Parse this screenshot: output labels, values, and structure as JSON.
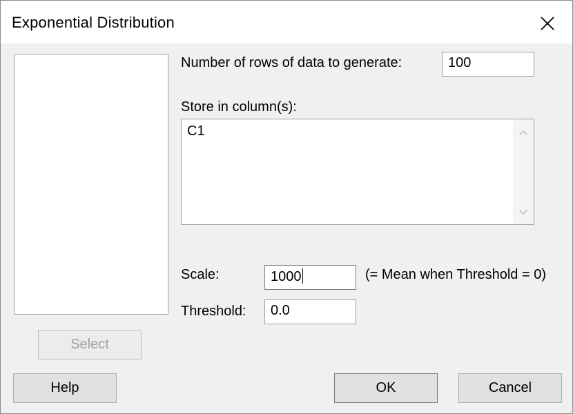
{
  "window": {
    "title": "Exponential Distribution"
  },
  "form": {
    "rows_label": "Number of rows of data to generate:",
    "rows_value": "100",
    "store_label": "Store in column(s):",
    "store_value": "C1",
    "scale_label": "Scale:",
    "scale_value": "1000",
    "scale_note": "(= Mean when Threshold = 0)",
    "threshold_label": "Threshold:",
    "threshold_value": "0.0"
  },
  "buttons": {
    "select": "Select",
    "help": "Help",
    "ok": "OK",
    "cancel": "Cancel"
  },
  "icons": {
    "close": "close-icon",
    "scroll_up": "chevron-up-icon",
    "scroll_down": "chevron-down-icon"
  }
}
